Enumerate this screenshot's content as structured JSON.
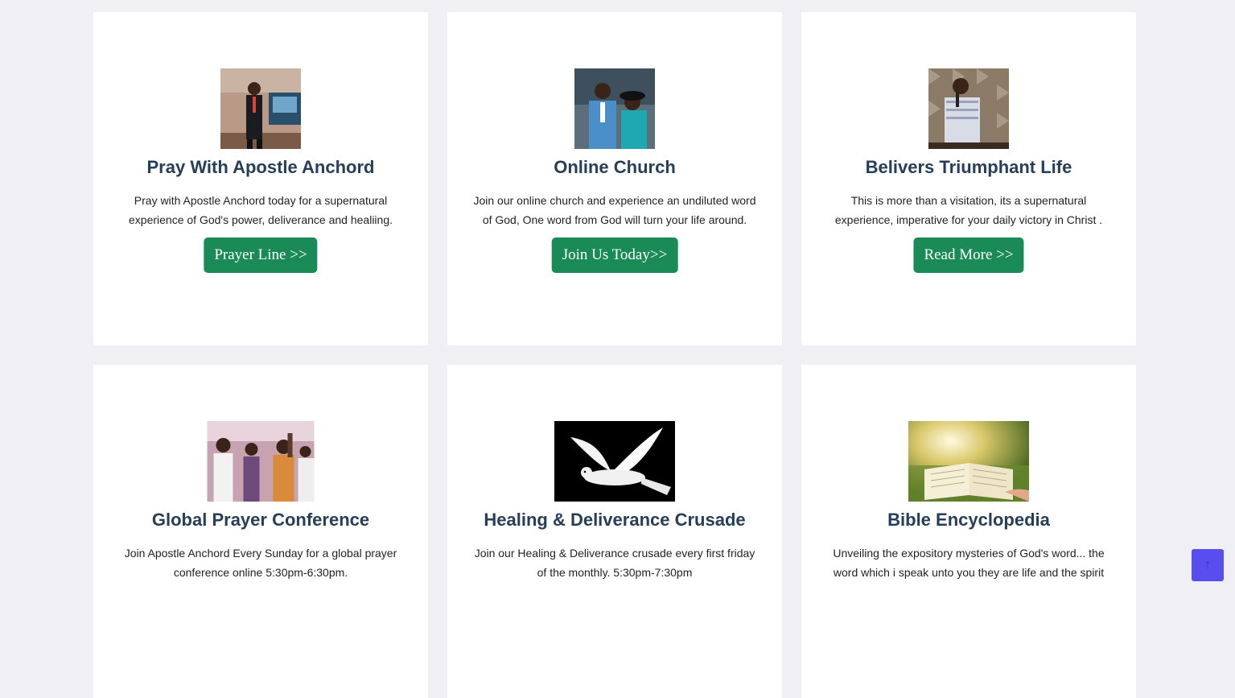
{
  "cards": [
    {
      "title": "Pray With Apostle Anchord",
      "desc": "Pray with Apostle Anchord today for a supernatural experience of God's power, deliverance and healiing.",
      "button": "Prayer Line >>"
    },
    {
      "title": "Online Church",
      "desc": "Join our online church and experience an undiluted word of God, One word from God will turn your life around.",
      "button": "Join Us Today>>"
    },
    {
      "title": "Belivers Triumphant Life",
      "desc": "This is more than a visitation, its a supernatural experience, imperative for your daily victory in Christ .",
      "button": "Read More >>"
    },
    {
      "title": "Global Prayer Conference",
      "desc": "Join Apostle Anchord Every Sunday for a global prayer conference online 5:30pm-6:30pm."
    },
    {
      "title": "Healing & Deliverance Crusade",
      "desc": "Join our Healing & Deliverance crusade every first friday of the monthly. 5:30pm-7:30pm"
    },
    {
      "title": "Bible Encyclopedia",
      "desc": "Unveiling the expository mysteries of God's word... the word which i speak unto you they are life and the spirit"
    }
  ],
  "scroll_top": {
    "icon": "arrow-up-icon",
    "label": "↑"
  },
  "colors": {
    "heading": "#263e57",
    "button": "#1a8a57",
    "page_bg": "#efeff4",
    "scroll_top": "#5a4df0"
  }
}
